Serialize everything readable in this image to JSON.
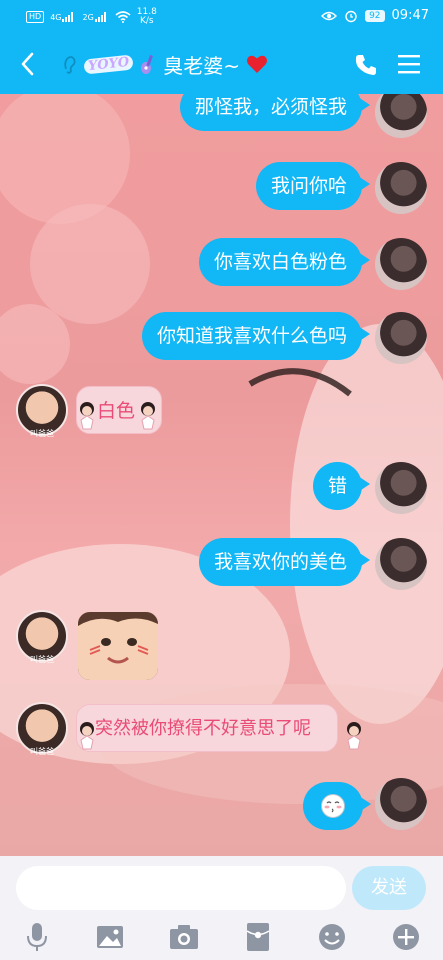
{
  "status_bar": {
    "hd": "HD",
    "net_a": "4G",
    "net_b": "2G",
    "speed_value": "11.8",
    "speed_unit": "K/s",
    "battery": "92",
    "time": "09:47"
  },
  "header": {
    "badge_text": "YOYO",
    "contact_name": "臭老婆~"
  },
  "messages": [
    {
      "side": "me",
      "text": "那怪我，必须怪我"
    },
    {
      "side": "me",
      "text": "我问你哈"
    },
    {
      "side": "me",
      "text": "你喜欢白色粉色"
    },
    {
      "side": "me",
      "text": "你知道我喜欢什么色吗"
    },
    {
      "side": "them",
      "text": "白色",
      "caption": "叫爸爸"
    },
    {
      "side": "me",
      "text": "错"
    },
    {
      "side": "me",
      "text": "我喜欢你的美色"
    },
    {
      "side": "them",
      "type": "image",
      "caption": "叫爸爸"
    },
    {
      "side": "them",
      "text": "突然被你撩得不好意思了呢",
      "caption": "叫爸爸"
    },
    {
      "side": "me",
      "type": "emoji"
    }
  ],
  "input": {
    "placeholder": "",
    "send_label": "发送"
  },
  "toolbar_icons": [
    "microphone-icon",
    "image-icon",
    "camera-icon",
    "red-packet-icon",
    "emoji-icon",
    "plus-icon"
  ],
  "colors": {
    "accent": "#12b7f5",
    "bubble_them": "#f7d7dc",
    "text_them": "#ea4b76",
    "send_disabled": "#bfe8fb"
  }
}
